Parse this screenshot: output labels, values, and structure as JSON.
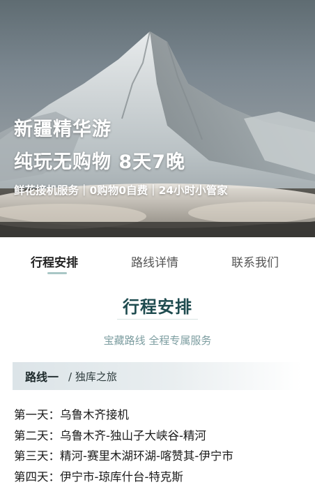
{
  "hero": {
    "title_line1": "新疆精华游",
    "title_line2": "纯玩无购物 8天7晚",
    "subtitle": "鲜花接机服务｜0购物0自费｜24小时小管家"
  },
  "tabs": [
    {
      "label": "行程安排",
      "active": true
    },
    {
      "label": "路线详情",
      "active": false
    },
    {
      "label": "联系我们",
      "active": false
    }
  ],
  "section": {
    "title": "行程安排",
    "subtitle": "宝藏路线 全程专属服务"
  },
  "route": {
    "name": "路线一",
    "desc": "/ 独库之旅"
  },
  "days": [
    {
      "text": "第一天：乌鲁木齐接机"
    },
    {
      "text": "第二天：乌鲁木齐-独山子大峡谷-精河"
    },
    {
      "text": "第三天：精河-赛里木湖环湖-喀赞其-伊宁市"
    },
    {
      "text": "第四天：伊宁市-琼库什台-特克斯"
    }
  ],
  "colors": {
    "accent": "#1e4b4f",
    "tab_underline": "#a9c7c6",
    "subtle_text": "#7c9da0"
  }
}
